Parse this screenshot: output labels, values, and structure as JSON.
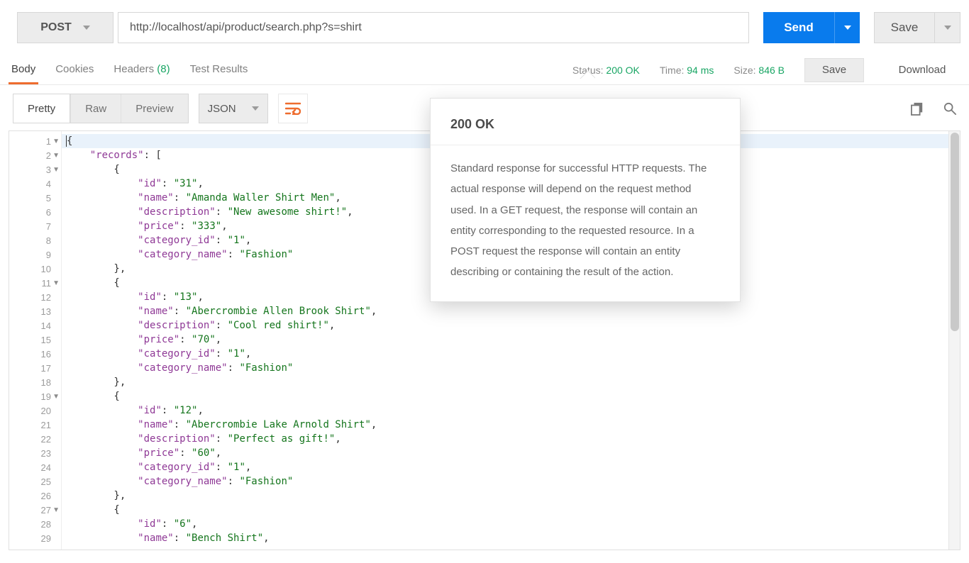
{
  "top": {
    "method": "POST",
    "url": "http://localhost/api/product/search.php?s=shirt",
    "send": "Send",
    "save": "Save"
  },
  "response_tabs": {
    "body": "Body",
    "cookies": "Cookies",
    "headers": "Headers",
    "headers_count": "(8)",
    "test_results": "Test Results"
  },
  "meta": {
    "status_k": "Status:",
    "status_v": "200 OK",
    "time_k": "Time:",
    "time_v": "94 ms",
    "size_k": "Size:",
    "size_v": "846 B",
    "save": "Save",
    "download": "Download"
  },
  "body_bar": {
    "pretty": "Pretty",
    "raw": "Raw",
    "preview": "Preview",
    "format": "JSON"
  },
  "tooltip": {
    "title": "200 OK",
    "body": "Standard response for successful HTTP requests. The actual response will depend on the request method used. In a GET request, the response will contain an entity corresponding to the requested resource. In a POST request the response will contain an entity describing or containing the result of the action."
  },
  "code": {
    "fold_lines": [
      1,
      2,
      3,
      11,
      19,
      27
    ],
    "lines": [
      [
        [
          "p",
          "{"
        ]
      ],
      [
        [
          "p",
          "    "
        ],
        [
          "key",
          "\"records\""
        ],
        [
          "p",
          ": ["
        ]
      ],
      [
        [
          "p",
          "        {"
        ]
      ],
      [
        [
          "p",
          "            "
        ],
        [
          "key",
          "\"id\""
        ],
        [
          "p",
          ": "
        ],
        [
          "str",
          "\"31\""
        ],
        [
          "p",
          ","
        ]
      ],
      [
        [
          "p",
          "            "
        ],
        [
          "key",
          "\"name\""
        ],
        [
          "p",
          ": "
        ],
        [
          "str",
          "\"Amanda Waller Shirt Men\""
        ],
        [
          "p",
          ","
        ]
      ],
      [
        [
          "p",
          "            "
        ],
        [
          "key",
          "\"description\""
        ],
        [
          "p",
          ": "
        ],
        [
          "str",
          "\"New awesome shirt!\""
        ],
        [
          "p",
          ","
        ]
      ],
      [
        [
          "p",
          "            "
        ],
        [
          "key",
          "\"price\""
        ],
        [
          "p",
          ": "
        ],
        [
          "str",
          "\"333\""
        ],
        [
          "p",
          ","
        ]
      ],
      [
        [
          "p",
          "            "
        ],
        [
          "key",
          "\"category_id\""
        ],
        [
          "p",
          ": "
        ],
        [
          "str",
          "\"1\""
        ],
        [
          "p",
          ","
        ]
      ],
      [
        [
          "p",
          "            "
        ],
        [
          "key",
          "\"category_name\""
        ],
        [
          "p",
          ": "
        ],
        [
          "str",
          "\"Fashion\""
        ]
      ],
      [
        [
          "p",
          "        },"
        ]
      ],
      [
        [
          "p",
          "        {"
        ]
      ],
      [
        [
          "p",
          "            "
        ],
        [
          "key",
          "\"id\""
        ],
        [
          "p",
          ": "
        ],
        [
          "str",
          "\"13\""
        ],
        [
          "p",
          ","
        ]
      ],
      [
        [
          "p",
          "            "
        ],
        [
          "key",
          "\"name\""
        ],
        [
          "p",
          ": "
        ],
        [
          "str",
          "\"Abercrombie Allen Brook Shirt\""
        ],
        [
          "p",
          ","
        ]
      ],
      [
        [
          "p",
          "            "
        ],
        [
          "key",
          "\"description\""
        ],
        [
          "p",
          ": "
        ],
        [
          "str",
          "\"Cool red shirt!\""
        ],
        [
          "p",
          ","
        ]
      ],
      [
        [
          "p",
          "            "
        ],
        [
          "key",
          "\"price\""
        ],
        [
          "p",
          ": "
        ],
        [
          "str",
          "\"70\""
        ],
        [
          "p",
          ","
        ]
      ],
      [
        [
          "p",
          "            "
        ],
        [
          "key",
          "\"category_id\""
        ],
        [
          "p",
          ": "
        ],
        [
          "str",
          "\"1\""
        ],
        [
          "p",
          ","
        ]
      ],
      [
        [
          "p",
          "            "
        ],
        [
          "key",
          "\"category_name\""
        ],
        [
          "p",
          ": "
        ],
        [
          "str",
          "\"Fashion\""
        ]
      ],
      [
        [
          "p",
          "        },"
        ]
      ],
      [
        [
          "p",
          "        {"
        ]
      ],
      [
        [
          "p",
          "            "
        ],
        [
          "key",
          "\"id\""
        ],
        [
          "p",
          ": "
        ],
        [
          "str",
          "\"12\""
        ],
        [
          "p",
          ","
        ]
      ],
      [
        [
          "p",
          "            "
        ],
        [
          "key",
          "\"name\""
        ],
        [
          "p",
          ": "
        ],
        [
          "str",
          "\"Abercrombie Lake Arnold Shirt\""
        ],
        [
          "p",
          ","
        ]
      ],
      [
        [
          "p",
          "            "
        ],
        [
          "key",
          "\"description\""
        ],
        [
          "p",
          ": "
        ],
        [
          "str",
          "\"Perfect as gift!\""
        ],
        [
          "p",
          ","
        ]
      ],
      [
        [
          "p",
          "            "
        ],
        [
          "key",
          "\"price\""
        ],
        [
          "p",
          ": "
        ],
        [
          "str",
          "\"60\""
        ],
        [
          "p",
          ","
        ]
      ],
      [
        [
          "p",
          "            "
        ],
        [
          "key",
          "\"category_id\""
        ],
        [
          "p",
          ": "
        ],
        [
          "str",
          "\"1\""
        ],
        [
          "p",
          ","
        ]
      ],
      [
        [
          "p",
          "            "
        ],
        [
          "key",
          "\"category_name\""
        ],
        [
          "p",
          ": "
        ],
        [
          "str",
          "\"Fashion\""
        ]
      ],
      [
        [
          "p",
          "        },"
        ]
      ],
      [
        [
          "p",
          "        {"
        ]
      ],
      [
        [
          "p",
          "            "
        ],
        [
          "key",
          "\"id\""
        ],
        [
          "p",
          ": "
        ],
        [
          "str",
          "\"6\""
        ],
        [
          "p",
          ","
        ]
      ],
      [
        [
          "p",
          "            "
        ],
        [
          "key",
          "\"name\""
        ],
        [
          "p",
          ": "
        ],
        [
          "str",
          "\"Bench Shirt\""
        ],
        [
          "p",
          ","
        ]
      ]
    ]
  }
}
